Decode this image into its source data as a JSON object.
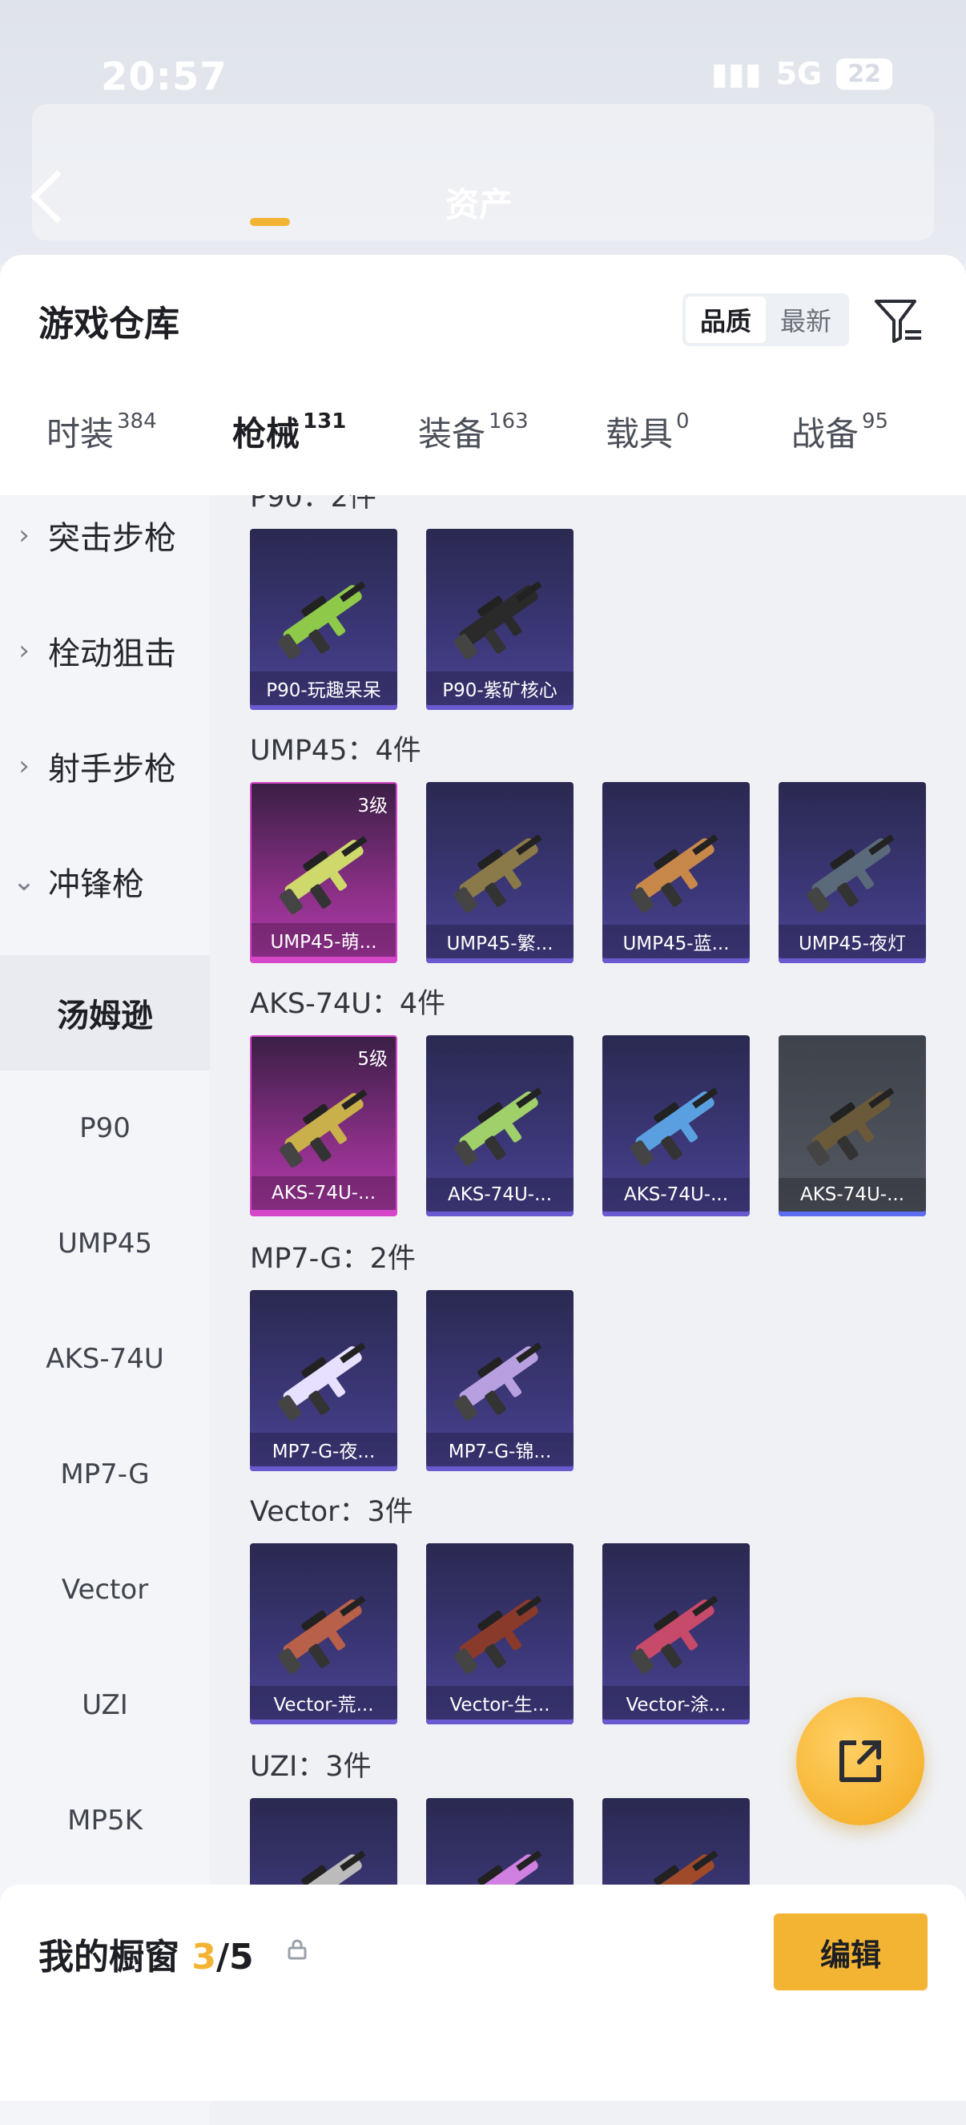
{
  "status_bar": {
    "time": "20:57",
    "network": "5G",
    "battery": "22"
  },
  "header": {
    "title": "资产"
  },
  "sheet": {
    "title": "游戏仓库",
    "sort_options": [
      {
        "label": "品质",
        "active": true
      },
      {
        "label": "最新",
        "active": false
      }
    ],
    "filter_icon": "filter-icon"
  },
  "tabs": [
    {
      "label": "时装",
      "count": "384"
    },
    {
      "label": "枪械",
      "count": "131",
      "active": true
    },
    {
      "label": "装备",
      "count": "163"
    },
    {
      "label": "载具",
      "count": "0"
    },
    {
      "label": "战备",
      "count": "95"
    }
  ],
  "sidebar": {
    "categories": [
      "突击步枪",
      "栓动狙击",
      "射手步枪",
      "冲锋枪"
    ],
    "subitems": [
      "汤姆逊",
      "P90",
      "UMP45",
      "AKS-74U",
      "MP7-G",
      "Vector",
      "UZI",
      "MP5K"
    ]
  },
  "groups": [
    {
      "title": "P90：2件",
      "items": [
        {
          "name": "P90-玩趣呆呆"
        },
        {
          "name": "P90-紫矿核心"
        }
      ]
    },
    {
      "title": "UMP45：4件",
      "items": [
        {
          "name": "UMP45-萌...",
          "level": "3级"
        },
        {
          "name": "UMP45-繁..."
        },
        {
          "name": "UMP45-蓝..."
        },
        {
          "name": "UMP45-夜灯"
        }
      ]
    },
    {
      "title": "AKS-74U：4件",
      "items": [
        {
          "name": "AKS-74U-...",
          "level": "5级"
        },
        {
          "name": "AKS-74U-..."
        },
        {
          "name": "AKS-74U-..."
        },
        {
          "name": "AKS-74U-..."
        }
      ]
    },
    {
      "title": "MP7-G：2件",
      "items": [
        {
          "name": "MP7-G-夜..."
        },
        {
          "name": "MP7-G-锦..."
        }
      ]
    },
    {
      "title": "Vector：3件",
      "items": [
        {
          "name": "Vector-荒..."
        },
        {
          "name": "Vector-生..."
        },
        {
          "name": "Vector-涂..."
        }
      ]
    },
    {
      "title": "UZI：3件",
      "items": [
        {
          "name": ""
        },
        {
          "name": ""
        },
        {
          "name": ""
        }
      ]
    }
  ],
  "showcase": {
    "title": "我的橱窗",
    "current": "3",
    "total": "/5",
    "edit_label": "编辑"
  },
  "colors": {
    "accent": "#f3b433",
    "purple_card": "#3c3778",
    "pink_card": "#b43cae"
  }
}
